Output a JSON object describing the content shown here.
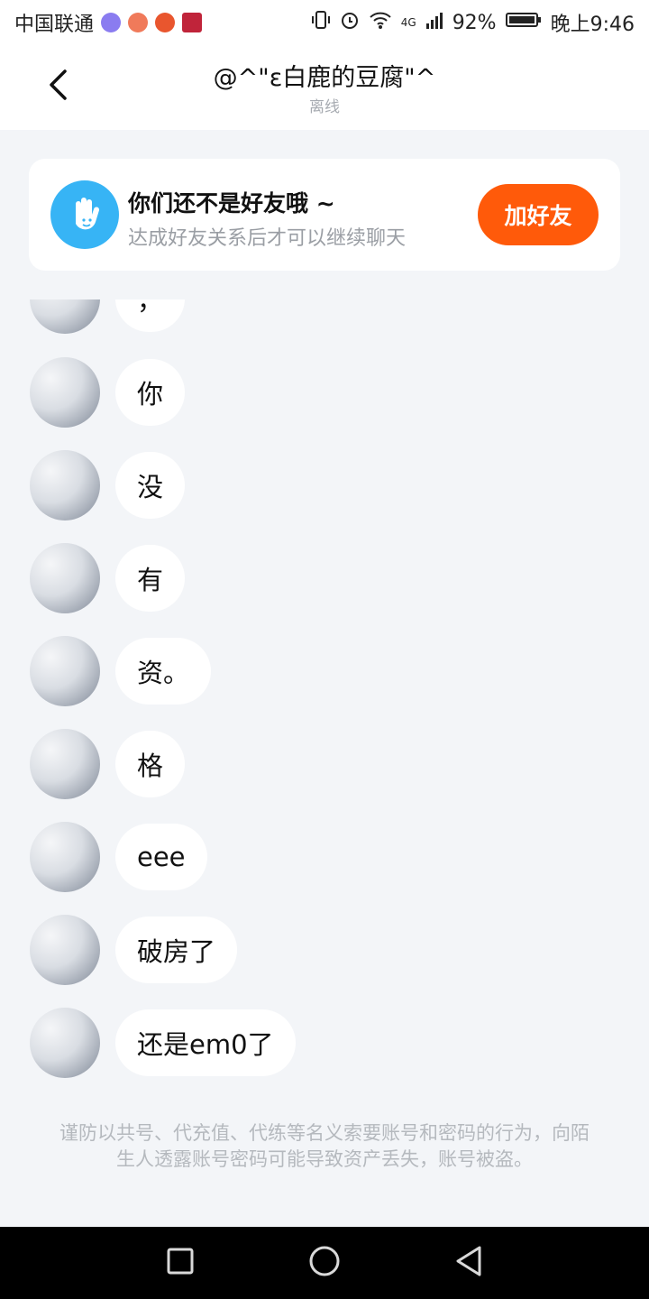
{
  "status_bar": {
    "carrier": "中国联通",
    "network": "4G",
    "battery": "92%",
    "time": "晚上9:46"
  },
  "header": {
    "title": "@^\"ε白鹿的豆腐\"^",
    "subtitle": "离线",
    "back_icon": "chevron-left-icon"
  },
  "friend_card": {
    "title": "你们还不是好友哦 ~",
    "subtitle": "达成好友关系后才可以继续聊天",
    "button_label": "加好友",
    "icon": "waving-hand-icon",
    "accent_color": "#ff5a0a"
  },
  "messages": [
    {
      "text": "，"
    },
    {
      "text": "你"
    },
    {
      "text": "没"
    },
    {
      "text": "有"
    },
    {
      "text": "资。"
    },
    {
      "text": "格"
    },
    {
      "text": "eee"
    },
    {
      "text": "破房了"
    },
    {
      "text": "还是em0了"
    }
  ],
  "notice": "谨防以共号、代充值、代练等名义索要账号和密码的行为，向陌生人透露账号密码可能导致资产丢失，账号被盗。",
  "nav_bar": {
    "icons": [
      "recent-apps-icon",
      "home-icon",
      "back-icon"
    ]
  }
}
